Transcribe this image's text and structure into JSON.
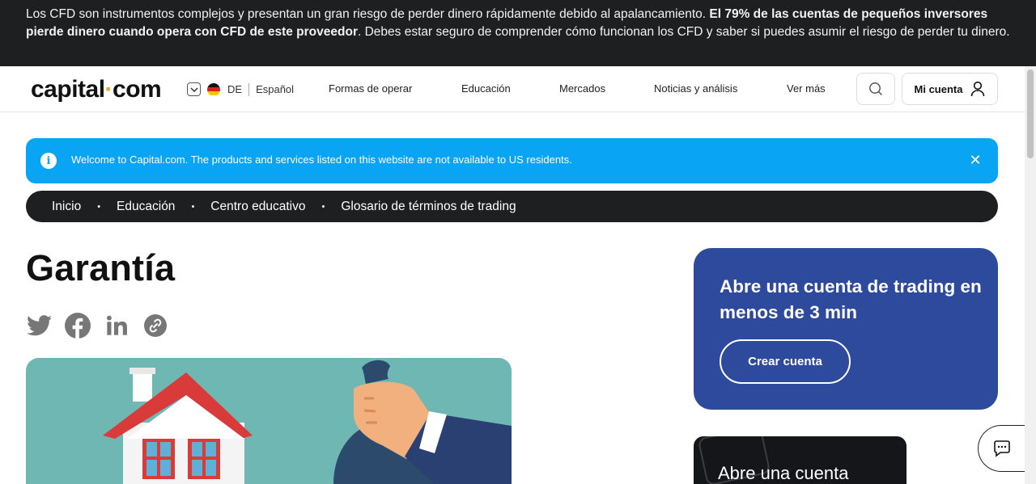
{
  "risk_banner": {
    "text_start": "Los CFD son instrumentos complejos y presentan un gran riesgo de perder dinero rápidamente debido al apalancamiento. ",
    "text_bold": "El 79% de las cuentas de pequeños inversores pierde dinero cuando opera con CFD de este proveedor",
    "text_end": ". Debes estar seguro de comprender cómo funcionan los CFD y saber si puedes asumir el riesgo de perder tu dinero."
  },
  "header": {
    "logo_left": "capital",
    "logo_dot": "·",
    "logo_right": "com",
    "region_code": "DE",
    "language": "Español",
    "nav": [
      "Formas de operar",
      "Educación",
      "Mercados",
      "Noticias y análisis",
      "Ver más"
    ],
    "account_label": "Mi cuenta"
  },
  "notice": {
    "info_glyph": "i",
    "message": "Welcome to Capital.com. The products and services listed on this website are not available to US residents.",
    "close_glyph": "✕"
  },
  "breadcrumb": [
    "Inicio",
    "Educación",
    "Centro educativo",
    "Glosario de términos de trading"
  ],
  "breadcrumb_sep": "•",
  "page": {
    "title": "Garantía"
  },
  "share_icons": [
    "twitter-icon",
    "facebook-icon",
    "linkedin-icon",
    "copy-link-icon"
  ],
  "promo": {
    "heading": "Abre una cuenta de trading en menos de 3 min",
    "button": "Crear cuenta"
  },
  "promo2": {
    "heading": "Abre una cuenta"
  },
  "colors": {
    "banner_bg": "#1e1f20",
    "notice_bg": "#0aa4f4",
    "promo_bg": "#2e4a9c",
    "logo_dot": "#e8a23b",
    "icon_gray": "#777777"
  }
}
